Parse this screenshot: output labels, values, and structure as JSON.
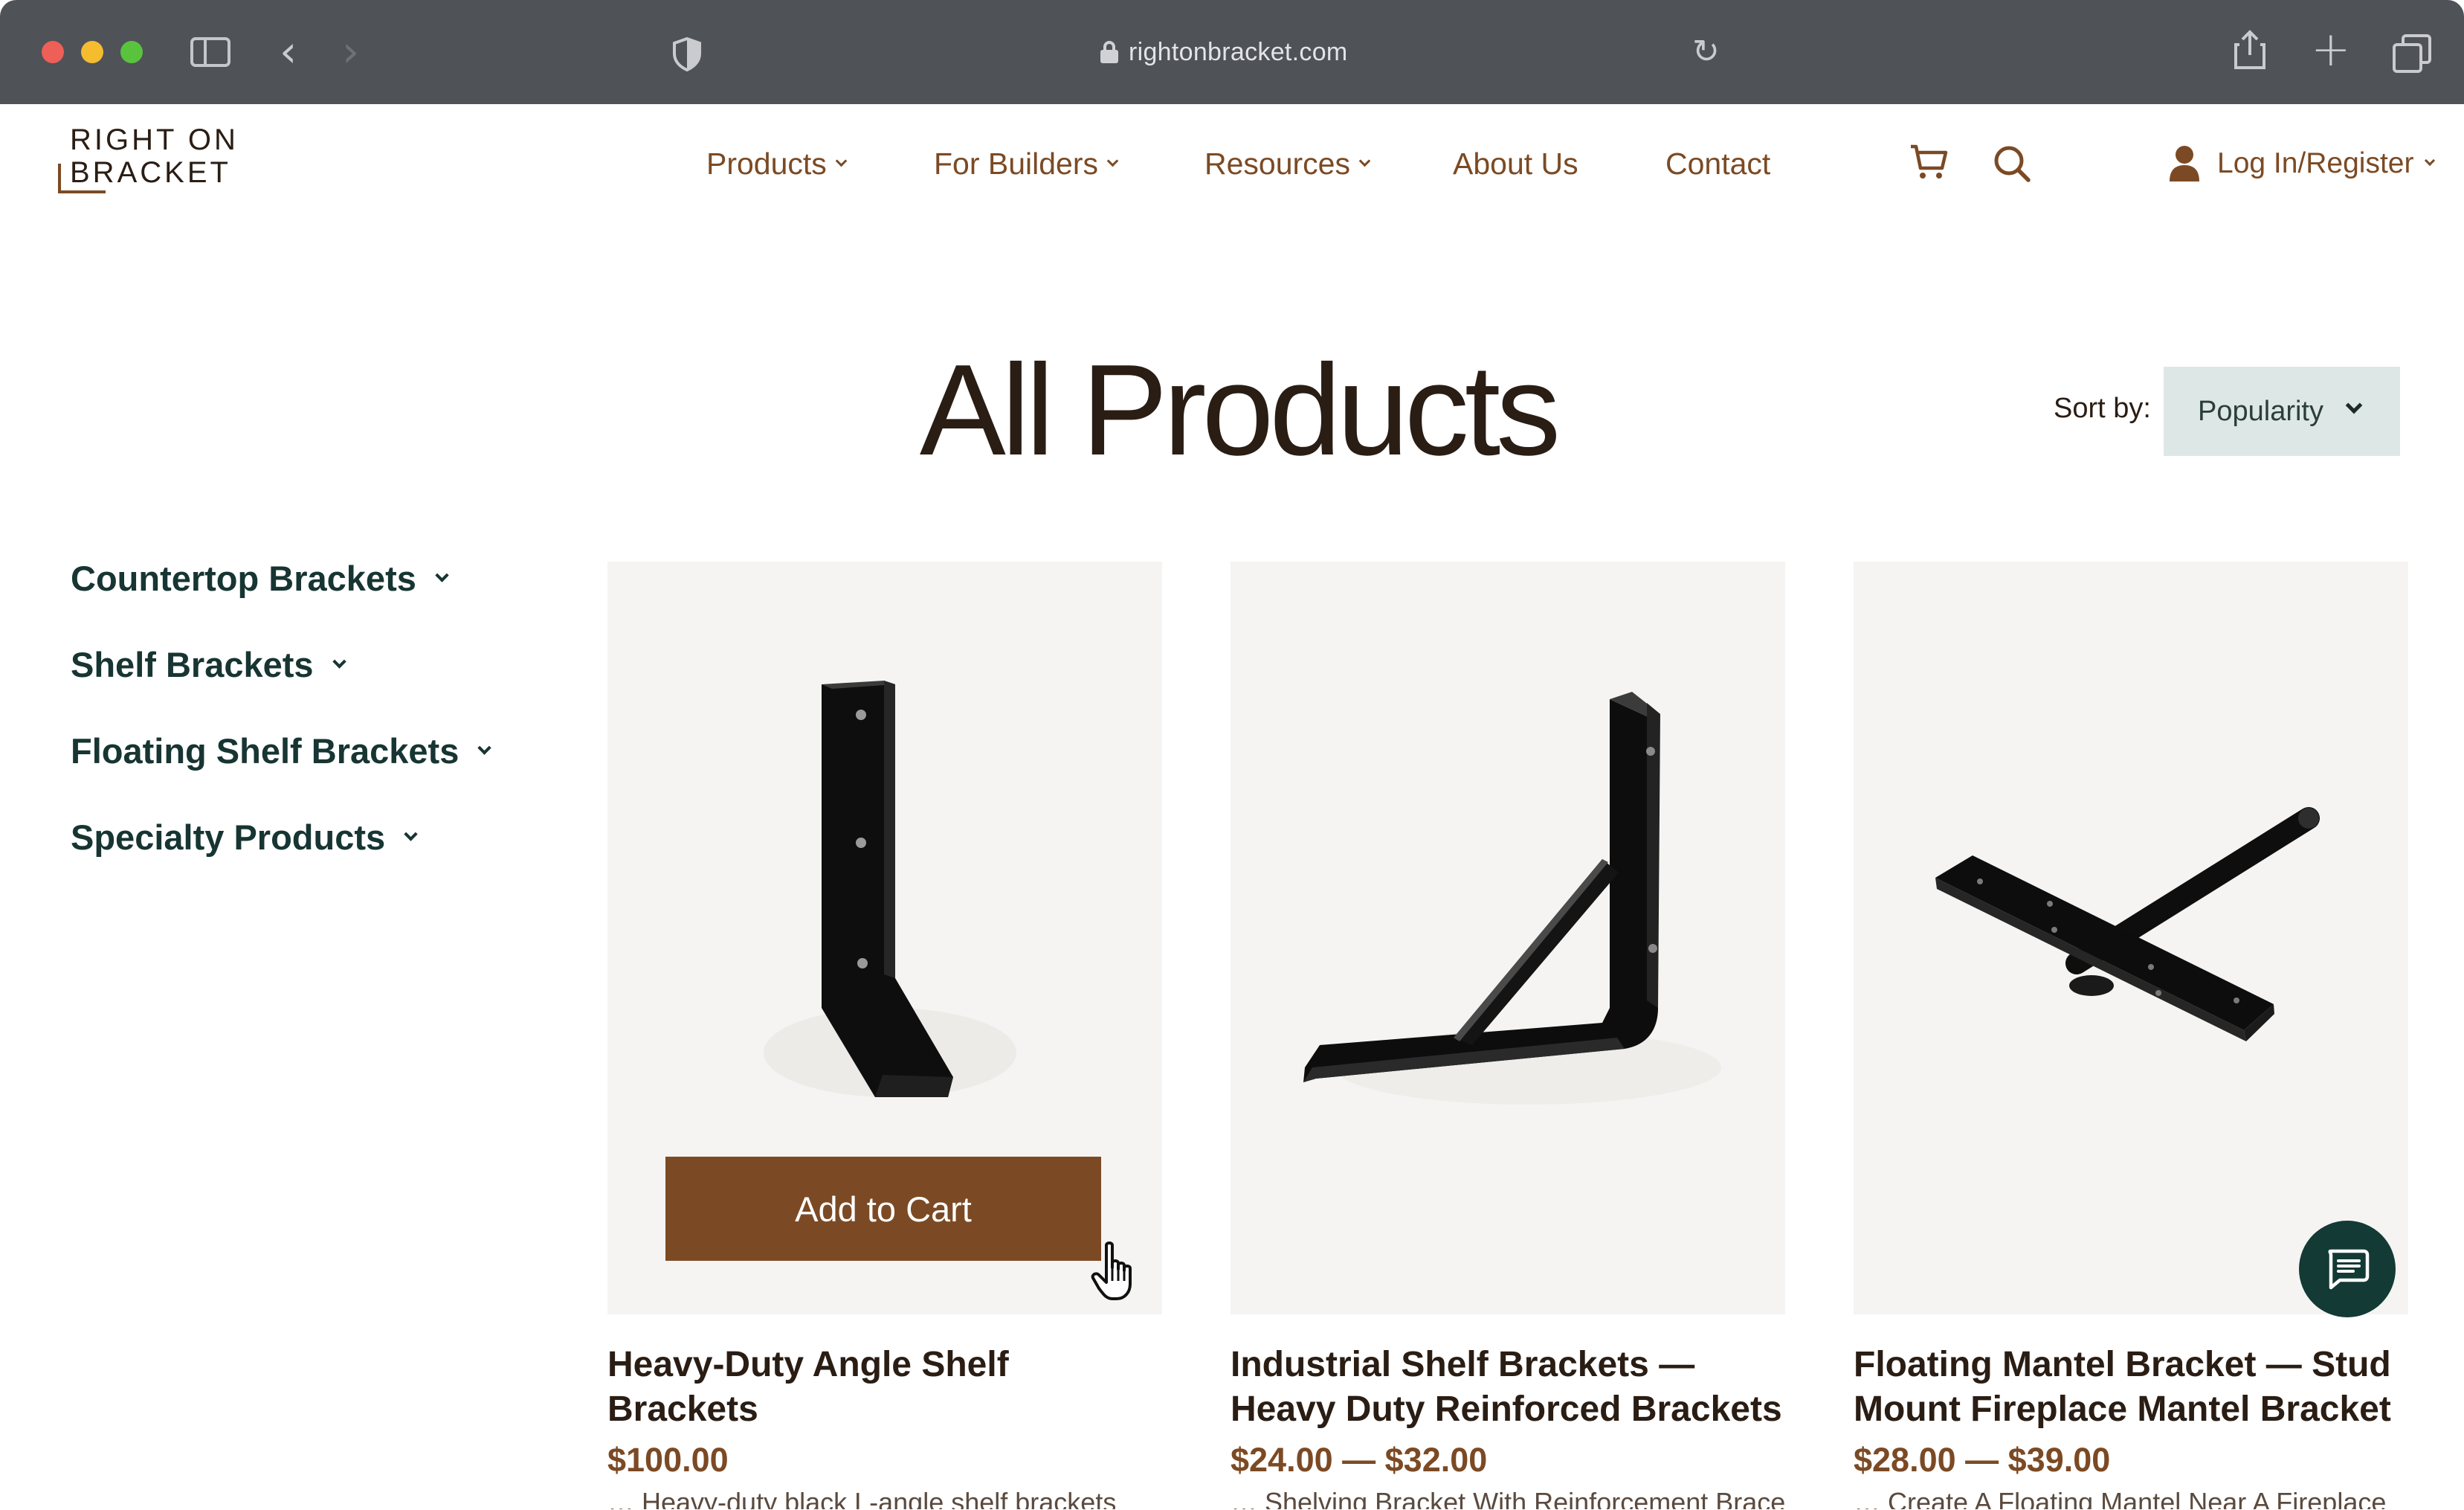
{
  "browser": {
    "url": "rightonbracket.com",
    "icons": {
      "sidebar": "sidebar-toggle-icon",
      "back": "chevron-left-icon",
      "forward": "chevron-right-icon",
      "privacy": "shield-icon",
      "lock": "lock-icon",
      "reload": "reload-icon",
      "share": "share-icon",
      "new_tab": "plus-icon",
      "tabs": "tabs-overview-icon"
    }
  },
  "header": {
    "logo_line1": "RIGHT ON",
    "logo_line2": "BRACKET",
    "nav": [
      {
        "label": "Products",
        "has_dropdown": true
      },
      {
        "label": "For Builders",
        "has_dropdown": true
      },
      {
        "label": "Resources",
        "has_dropdown": true
      },
      {
        "label": "About Us",
        "has_dropdown": false
      },
      {
        "label": "Contact",
        "has_dropdown": false
      }
    ],
    "account_label": "Log In/Register"
  },
  "page": {
    "title": "All Products",
    "sort_label": "Sort by:",
    "sort_value": "Popularity"
  },
  "sidebar": {
    "categories": [
      {
        "label": "Countertop Brackets"
      },
      {
        "label": "Shelf Brackets"
      },
      {
        "label": "Floating Shelf Brackets"
      },
      {
        "label": "Specialty Products"
      }
    ]
  },
  "products": [
    {
      "title": "Heavy-Duty Angle Shelf Brackets",
      "price": "$100.00",
      "add_to_cart": "Add to Cart",
      "description": "… Heavy-duty black L-angle shelf brackets"
    },
    {
      "title": "Industrial Shelf Brackets — Heavy Duty Reinforced Brackets",
      "price": "$24.00 — $32.00",
      "description": "… Shelving Bracket With Reinforcement Brace"
    },
    {
      "title": "Floating Mantel Bracket — Stud Mount Fireplace Mantel Bracket",
      "price": "$28.00 — $39.00",
      "description": "… Create A Floating Mantel Near A Fireplace"
    }
  ],
  "colors": {
    "brand_brown": "#7b4a24",
    "dark_text": "#2a1d14",
    "sidebar_green": "#173532",
    "sort_bg": "#dde8e6",
    "chat_bg": "#133a35",
    "chrome_bg": "#4f5257"
  }
}
